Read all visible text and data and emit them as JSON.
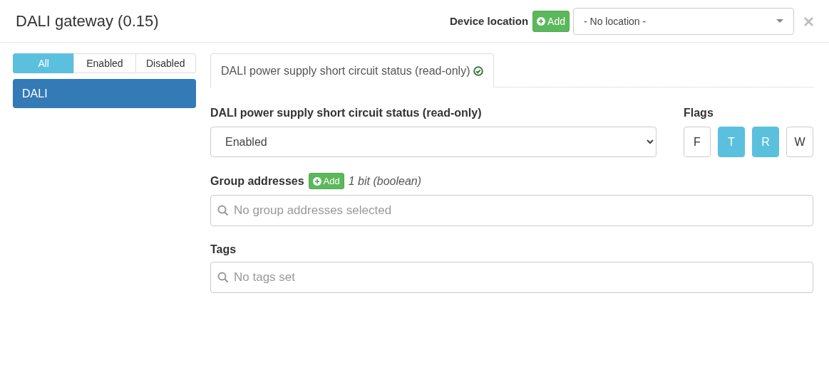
{
  "window": {
    "title": "DALI gateway (0.15)"
  },
  "device_location": {
    "label": "Device location",
    "add_button": "Add",
    "select_value": "- No location -"
  },
  "filters": [
    {
      "label": "All",
      "selected": true
    },
    {
      "label": "Enabled",
      "selected": false
    },
    {
      "label": "Disabled",
      "selected": false
    }
  ],
  "sidebar": {
    "items": [
      {
        "label": "DALI",
        "selected": true
      }
    ]
  },
  "tabs": [
    {
      "label": "DALI power supply short circuit status (read-only)",
      "selected": true,
      "valid": true
    }
  ],
  "form": {
    "value_label": "DALI power supply short circuit status (read-only)",
    "value": "Enabled",
    "flags_label": "Flags",
    "flags": [
      {
        "label": "F",
        "selected": false
      },
      {
        "label": "T",
        "selected": true
      },
      {
        "label": "R",
        "selected": true
      },
      {
        "label": "W",
        "selected": false
      }
    ],
    "group_addresses": {
      "label": "Group addresses",
      "add_button": "Add",
      "type": "1 bit (boolean)",
      "placeholder": "No group addresses selected"
    },
    "tags": {
      "label": "Tags",
      "placeholder": "No tags set"
    }
  }
}
